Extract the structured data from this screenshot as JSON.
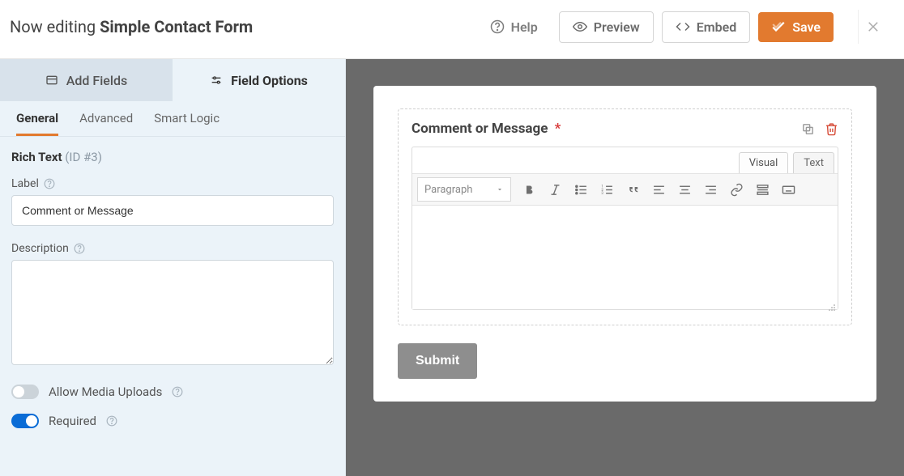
{
  "header": {
    "editing_prefix": "Now editing ",
    "form_name": "Simple Contact Form",
    "help": "Help",
    "preview": "Preview",
    "embed": "Embed",
    "save": "Save"
  },
  "sidebar": {
    "main_tabs": {
      "add_fields": "Add Fields",
      "field_options": "Field Options"
    },
    "sub_tabs": {
      "general": "General",
      "advanced": "Advanced",
      "smart_logic": "Smart Logic"
    },
    "field_header": {
      "type": "Rich Text",
      "id_text": "(ID #3)"
    },
    "label_label": "Label",
    "label_value": "Comment or Message",
    "description_label": "Description",
    "description_value": "",
    "allow_media_uploads": "Allow Media Uploads",
    "required_label": "Required"
  },
  "preview": {
    "field_label": "Comment or Message",
    "required_mark": "*",
    "rte_tabs": {
      "visual": "Visual",
      "text": "Text"
    },
    "paragraph_select": "Paragraph",
    "submit": "Submit"
  }
}
